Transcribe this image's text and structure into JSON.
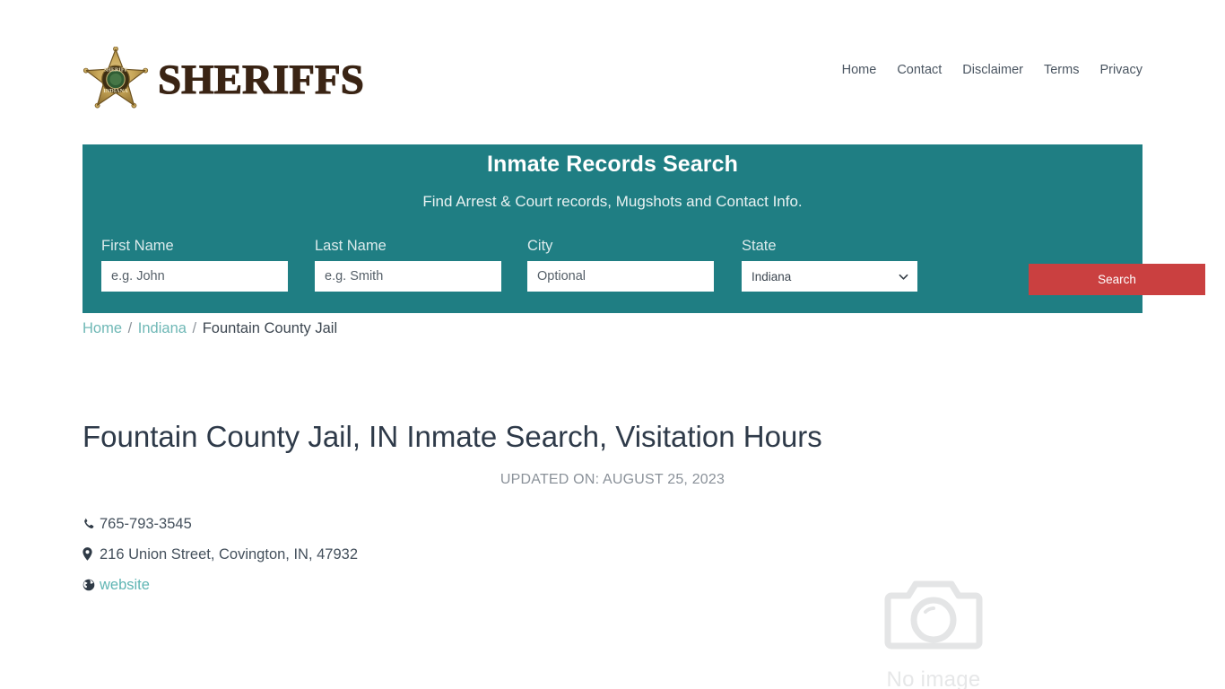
{
  "header": {
    "logo_word": "SHERIFFS",
    "logo_badge_alt": "sheriff-star-badge",
    "nav": [
      {
        "label": "Home"
      },
      {
        "label": "Contact"
      },
      {
        "label": "Disclaimer"
      },
      {
        "label": "Terms"
      },
      {
        "label": "Privacy"
      }
    ]
  },
  "search_band": {
    "title": "Inmate Records Search",
    "subtitle": "Find Arrest & Court records, Mugshots and Contact Info.",
    "accent_bg": "#1f7e83",
    "button_color": "#ca4040",
    "fields": {
      "first_name": {
        "label": "First Name",
        "placeholder": "e.g. John",
        "value": ""
      },
      "last_name": {
        "label": "Last Name",
        "placeholder": "e.g. Smith",
        "value": ""
      },
      "city": {
        "label": "City",
        "placeholder": "Optional",
        "value": ""
      },
      "state": {
        "label": "State",
        "selected": "Indiana",
        "options": [
          "Indiana"
        ]
      }
    },
    "submit_label": "Search"
  },
  "breadcrumb": {
    "items": [
      {
        "label": "Home",
        "link": true
      },
      {
        "label": "Indiana",
        "link": true
      },
      {
        "label": "Fountain County Jail",
        "link": false
      }
    ],
    "separator": "/"
  },
  "main": {
    "title": "Fountain County Jail, IN Inmate Search, Visitation Hours",
    "updated": "UPDATED ON: AUGUST 25, 2023",
    "contact": {
      "phone": "765-793-3545",
      "address": "216 Union Street, Covington, IN, 47932",
      "website_label": "website"
    },
    "no_image": {
      "label": "No image",
      "color": "#e6e7e8"
    }
  }
}
